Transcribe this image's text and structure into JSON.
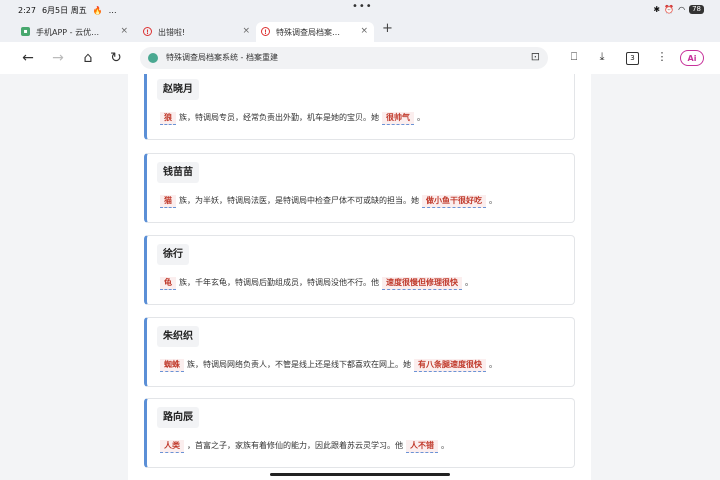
{
  "status": {
    "time": "2:27",
    "date": "6月5日 周五",
    "extra": "…",
    "center": "•••",
    "battery": "78"
  },
  "tabs": [
    {
      "title": "手机APP - 云优…",
      "icon": "app-icon"
    },
    {
      "title": "出错啦!",
      "icon": "warning-icon"
    },
    {
      "title": "特殊调查局档案…",
      "icon": "warning-icon"
    }
  ],
  "toolbar": {
    "url": "特殊调查局档案系统 - 档案重建",
    "tab_count": "3",
    "ai_label": "Ai"
  },
  "cards": [
    {
      "name": "赵晓月",
      "race": "狼",
      "text": "族，特调局专员，经常负责出外勤，机车是她的宝贝。她",
      "trait": "很帅气",
      "end": "。"
    },
    {
      "name": "钱苗苗",
      "race": "猫",
      "text": "族，为半妖，特调局法医，是特调局中检查尸体不可或缺的担当。她",
      "trait": "做小鱼干很好吃",
      "end": "。"
    },
    {
      "name": "徐行",
      "race": "龟",
      "text": "族，千年玄龟，特调局后勤组成员，特调局没他不行。他",
      "trait": "速度很慢但修理很快",
      "end": "。"
    },
    {
      "name": "朱织织",
      "race": "蜘蛛",
      "text": "族，特调局网络负责人，不管是线上还是线下都喜欢在网上。她",
      "trait": "有八条腿速度很快",
      "end": "。"
    },
    {
      "name": "路向辰",
      "race": "人类",
      "text": "，首富之子，家族有着修仙的能力，因此跟着苏云灵学习。他",
      "trait": "人不错",
      "end": "。"
    }
  ],
  "colors": {
    "accent": "#5b8fd6",
    "highlight_text": "#c0392b",
    "highlight_bg": "#fbeeee"
  }
}
